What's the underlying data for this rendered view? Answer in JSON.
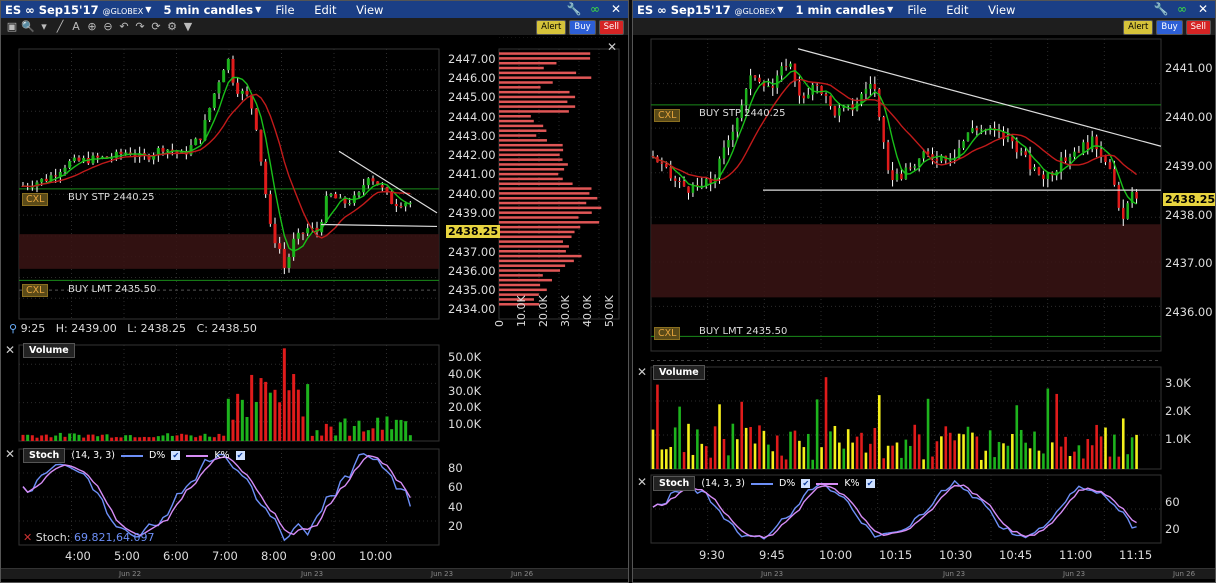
{
  "left": {
    "title": {
      "symbol": "ES ∞ Sep15'17",
      "exchange": "@GLOBEX",
      "interval": "5 min candles"
    },
    "menu": [
      "File",
      "Edit",
      "View"
    ],
    "buttons": {
      "alert": "Alert",
      "buy": "Buy",
      "sell": "Sell"
    },
    "price_axis": [
      "2447.00",
      "2446.00",
      "2445.00",
      "2444.00",
      "2443.00",
      "2442.00",
      "2441.00",
      "2440.00",
      "2439.00",
      "2438.00",
      "2437.00",
      "2436.00",
      "2435.00",
      "2434.00"
    ],
    "last_price": "2438.25",
    "orders": {
      "stop_tag": "CXL",
      "stop_label": "BUY STP 2440.25",
      "limit_tag": "CXL",
      "limit_label": "BUY LMT 2435.50"
    },
    "ohlc": {
      "time": "9:25",
      "h": "H: 2439.00",
      "l": "L: 2438.25",
      "c": "C: 2438.50"
    },
    "volume_profile_axis": [
      "0",
      "10.0K",
      "20.0K",
      "30.0K",
      "40.0K",
      "50.0K"
    ],
    "volume": {
      "label": "Volume",
      "axis": [
        "50.0K",
        "40.0K",
        "30.0K",
        "20.0K",
        "10.0K"
      ]
    },
    "stoch": {
      "label": "Stoch",
      "params": "(14, 3, 3)",
      "d_label": "D%",
      "k_label": "K%",
      "axis": [
        "80",
        "60",
        "40",
        "20"
      ],
      "readout_label": "Stoch:",
      "readout_values": "69.821,64.097"
    },
    "time_axis": [
      "4:00",
      "5:00",
      "6:00",
      "7:00",
      "8:00",
      "9:00",
      "10:00"
    ],
    "dates": [
      "Jun 22",
      "Jun 23",
      "Jun 23",
      "Jun 26"
    ]
  },
  "right": {
    "title": {
      "symbol": "ES ∞ Sep15'17",
      "exchange": "@GLOBEX",
      "interval": "1 min candles"
    },
    "menu": [
      "File",
      "Edit",
      "View"
    ],
    "buttons": {
      "alert": "Alert",
      "buy": "Buy",
      "sell": "Sell"
    },
    "price_axis": [
      "2441.00",
      "2440.00",
      "2439.00",
      "2438.00",
      "2437.00",
      "2436.00"
    ],
    "last_price": "2438.25",
    "orders": {
      "stop_tag": "CXL",
      "stop_label": "BUY STP 2440.25",
      "limit_tag": "CXL",
      "limit_label": "BUY LMT 2435.50"
    },
    "volume": {
      "label": "Volume",
      "axis": [
        "3.0K",
        "2.0K",
        "1.0K"
      ]
    },
    "stoch": {
      "label": "Stoch",
      "params": "(14, 3, 3)",
      "d_label": "D%",
      "k_label": "K%",
      "axis": [
        "60",
        "20"
      ]
    },
    "time_axis": [
      "9:30",
      "9:45",
      "10:00",
      "10:15",
      "10:30",
      "10:45",
      "11:00",
      "11:15"
    ],
    "dates": [
      "Jun 23",
      "Jun 23",
      "Jun 23",
      "Jun 26"
    ]
  },
  "colors": {
    "titlebar": "#1b3f86",
    "up": "#1db31d",
    "down": "#e01b1b",
    "k_line": "#6d8ff7",
    "d_line": "#d68cf5",
    "volume_neutral": "#f5f01c",
    "profile": "#e05656"
  }
}
